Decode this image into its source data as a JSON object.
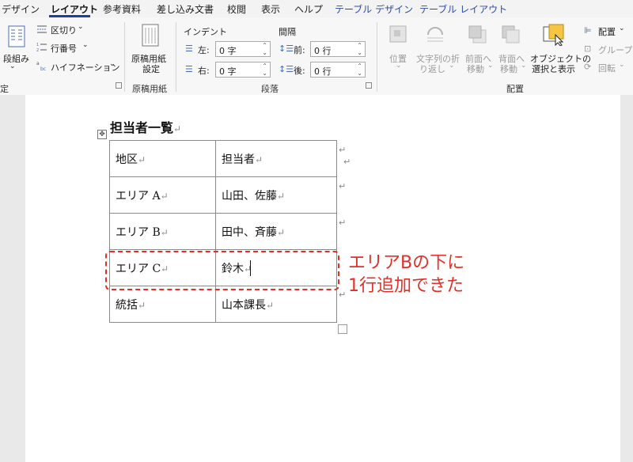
{
  "tabs": [
    {
      "label": "デザイン",
      "state": "normal"
    },
    {
      "label": "レイアウト",
      "state": "active"
    },
    {
      "label": "参考資料",
      "state": "normal"
    },
    {
      "label": "差し込み文書",
      "state": "normal"
    },
    {
      "label": "校閲",
      "state": "normal"
    },
    {
      "label": "表示",
      "state": "normal"
    },
    {
      "label": "ヘルプ",
      "state": "normal"
    },
    {
      "label": "テーブル デザイン",
      "state": "context"
    },
    {
      "label": "テーブル レイアウト",
      "state": "context"
    }
  ],
  "ribbon": {
    "page_setup": {
      "columns_label": "段組み",
      "breaks_label": "区切り",
      "line_numbers_label": "行番号",
      "hyphenation_label": "ハイフネーション",
      "group_label_partial": "定"
    },
    "manuscript": {
      "button_line1": "原稿用紙",
      "button_line2": "設定",
      "group_label": "原稿用紙"
    },
    "paragraph": {
      "indent_header": "インデント",
      "spacing_header": "間隔",
      "left_label": "左:",
      "left_value": "0 字",
      "right_label": "右:",
      "right_value": "0 字",
      "before_label": "前:",
      "before_value": "0 行",
      "after_label": "後:",
      "after_value": "0 行",
      "group_label": "段落"
    },
    "arrange": {
      "position_label": "位置",
      "wrap_line1": "文字列の折",
      "wrap_line2": "り返し",
      "forward_line1": "前面へ",
      "forward_line2": "移動",
      "backward_line1": "背面へ",
      "backward_line2": "移動",
      "selection_line1": "オブジェクトの",
      "selection_line2": "選択と表示",
      "align_label": "配置",
      "group_obj_label": "グループ化",
      "rotate_label": "回転",
      "group_label": "配置"
    }
  },
  "document": {
    "title": "担当者一覧",
    "table": [
      [
        "地区",
        "担当者"
      ],
      [
        "エリア A",
        "山田、佐藤"
      ],
      [
        "エリア B",
        "田中、斉藤"
      ],
      [
        "エリア C",
        "鈴木"
      ],
      [
        "統括",
        "山本課長"
      ]
    ],
    "paragraph_mark": "↵"
  },
  "annotation": {
    "line1": "エリアBの下に",
    "line2": "1行追加できた",
    "color": "#e0302a"
  },
  "colors": {
    "accent_tab": "#1f3f9a",
    "context_tab": "#2a4aa8"
  }
}
